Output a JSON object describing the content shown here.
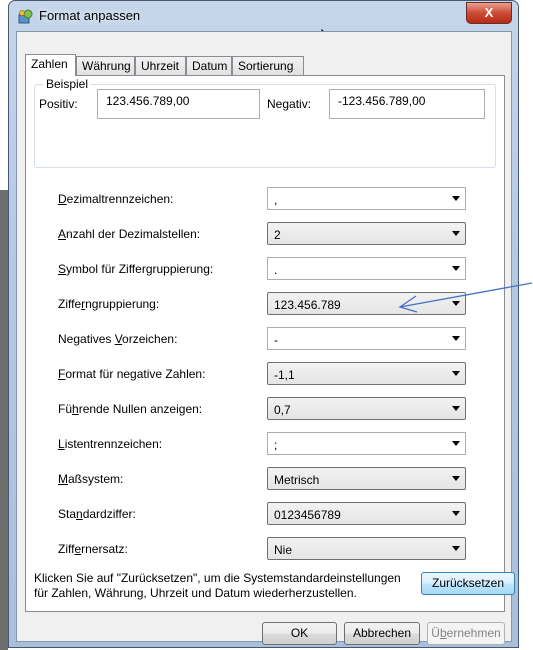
{
  "window": {
    "title": "Format anpassen",
    "close_label": "X"
  },
  "tabs": [
    {
      "label": "Zahlen",
      "active": true
    },
    {
      "label": "Währung",
      "active": false
    },
    {
      "label": "Uhrzeit",
      "active": false
    },
    {
      "label": "Datum",
      "active": false
    },
    {
      "label": "Sortierung",
      "active": false
    }
  ],
  "example": {
    "legend": "Beispiel",
    "positive_label": "Positiv:",
    "positive_value": "123.456.789,00",
    "negative_label": "Negativ:",
    "negative_value": "-123.456.789,00"
  },
  "settings": [
    {
      "pre": "",
      "key": "D",
      "post": "ezimaltrennzeichen:",
      "value": ",",
      "kind": "editable"
    },
    {
      "pre": "",
      "key": "A",
      "post": "nzahl der Dezimalstellen:",
      "value": "2",
      "kind": "dropdown"
    },
    {
      "pre": "",
      "key": "S",
      "post": "ymbol für Ziffergruppierung:",
      "value": ".",
      "kind": "editable"
    },
    {
      "pre": "Ziffe",
      "key": "r",
      "post": "ngruppierung:",
      "value": "123.456.789",
      "kind": "dropdown"
    },
    {
      "pre": "Negatives ",
      "key": "V",
      "post": "orzeichen:",
      "value": "-",
      "kind": "editable"
    },
    {
      "pre": "",
      "key": "F",
      "post": "ormat für negative Zahlen:",
      "value": "-1,1",
      "kind": "dropdown"
    },
    {
      "pre": "Fü",
      "key": "h",
      "post": "rende Nullen anzeigen:",
      "value": "0,7",
      "kind": "dropdown"
    },
    {
      "pre": "",
      "key": "L",
      "post": "istentrennzeichen:",
      "value": ";",
      "kind": "editable"
    },
    {
      "pre": "",
      "key": "M",
      "post": "aßsystem:",
      "value": "Metrisch",
      "kind": "dropdown"
    },
    {
      "pre": "Sta",
      "key": "n",
      "post": "dardziffer:",
      "value": "0123456789",
      "kind": "dropdown"
    },
    {
      "pre": "Ziff",
      "key": "e",
      "post": "rnersatz:",
      "value": "Nie",
      "kind": "dropdown"
    }
  ],
  "reset": {
    "text": "Klicken Sie auf \"Zurücksetzen\", um die Systemstandardeinstellungen für Zahlen, Währung, Uhrzeit und Datum wiederherzustellen.",
    "button": "Zurücksetzen"
  },
  "footer": {
    "ok": "OK",
    "cancel": "Abbrechen",
    "apply_pre": "Ü",
    "apply_key": "b",
    "apply_post": "ernehmen"
  },
  "colors": {
    "annotation_arrow": "#4472c4"
  }
}
